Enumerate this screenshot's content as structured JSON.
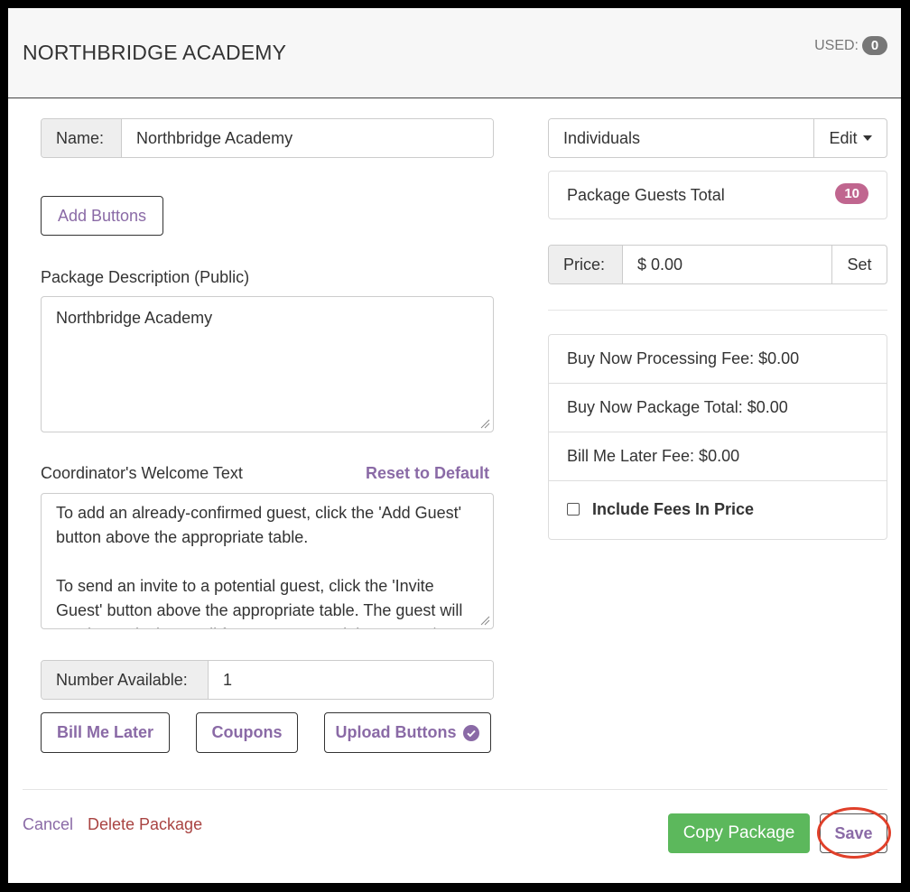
{
  "header": {
    "title": "NORTHBRIDGE ACADEMY",
    "used_label": "USED:",
    "used_count": "0"
  },
  "form": {
    "name_label": "Name:",
    "name_value": "Northbridge Academy",
    "add_buttons_label": "Add Buttons",
    "description_label": "Package Description (Public)",
    "description_value": "Northbridge Academy",
    "welcome_label": "Coordinator's Welcome Text",
    "reset_label": "Reset to Default",
    "welcome_text_1": "To add an already-confirmed guest, click the 'Add Guest' button above the appropriate table.",
    "welcome_text_2": "To send an invite to a potential guest, click the 'Invite Guest' button above the appropriate table. The guest will receive an invite email for you on potential on guest / as",
    "number_label": "Number Available:",
    "number_value": "1",
    "bill_me_later_label": "Bill Me Later",
    "coupons_label": "Coupons",
    "upload_buttons_label": "Upload Buttons"
  },
  "side": {
    "package_type": "Individuals",
    "edit_label": "Edit",
    "guests_total_label": "Package Guests Total",
    "guests_total_count": "10",
    "price_label": "Price:",
    "price_value": "$ 0.00",
    "set_label": "Set",
    "fees": {
      "processing_fee": "Buy Now Processing Fee: $0.00",
      "package_total": "Buy Now Package Total: $0.00",
      "bill_later_fee": "Bill Me Later Fee: $0.00",
      "include_fees_label": "Include Fees In Price"
    }
  },
  "footer": {
    "cancel_label": "Cancel",
    "delete_label": "Delete Package",
    "copy_label": "Copy Package",
    "save_label": "Save"
  },
  "colors": {
    "accent_purple": "#8a6aa6",
    "delete_red": "#a94442",
    "success_green": "#5cb85c",
    "badge_pink": "#c0668f",
    "highlight_circle": "#e0402a"
  }
}
